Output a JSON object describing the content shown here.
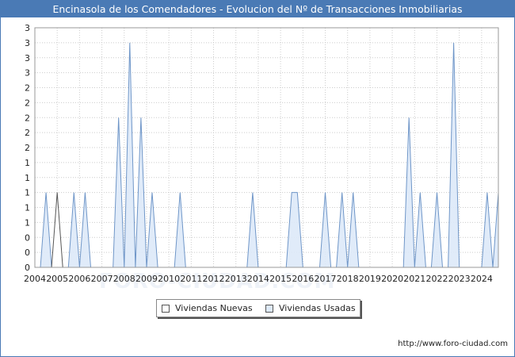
{
  "chart_data": {
    "type": "area",
    "title": "Encinasola de los Comendadores - Evolucion del Nº de Transacciones Inmobiliarias",
    "x_ticks": [
      "2004",
      "2005",
      "2006",
      "2007",
      "2008",
      "2009",
      "2010",
      "2011",
      "2012",
      "2013",
      "2014",
      "2015",
      "2016",
      "2017",
      "2018",
      "2019",
      "2020",
      "2021",
      "2022",
      "2023",
      "2024"
    ],
    "y_ticks": [
      "0",
      "0",
      "0",
      "1",
      "1",
      "1",
      "1",
      "1",
      "2",
      "2",
      "2",
      "2",
      "2",
      "3",
      "3",
      "3",
      "3"
    ],
    "ylim": [
      0,
      3.2
    ],
    "xlim": [
      2004,
      2024.75
    ],
    "grid": true,
    "legend_position": "bottom",
    "series": [
      {
        "name": "Viviendas Nuevas",
        "fill": "#ffffff",
        "stroke": "#555555",
        "points": [
          [
            2004.75,
            0
          ],
          [
            2005.0,
            1
          ],
          [
            2005.25,
            0
          ]
        ]
      },
      {
        "name": "Viviendas Usadas",
        "fill": "#dde9f8",
        "stroke": "#6f96c8",
        "points": [
          [
            2004.25,
            0
          ],
          [
            2004.5,
            1
          ],
          [
            2004.75,
            0
          ],
          [
            2005.5,
            0
          ],
          [
            2005.75,
            1
          ],
          [
            2006.0,
            0
          ],
          [
            2006.25,
            1
          ],
          [
            2006.5,
            0
          ],
          [
            2007.5,
            0
          ],
          [
            2007.75,
            2
          ],
          [
            2008.0,
            0
          ],
          [
            2008.25,
            3
          ],
          [
            2008.5,
            0
          ],
          [
            2008.75,
            2
          ],
          [
            2009.0,
            0
          ],
          [
            2009.25,
            1
          ],
          [
            2009.5,
            0
          ],
          [
            2010.25,
            0
          ],
          [
            2010.5,
            1
          ],
          [
            2010.75,
            0
          ],
          [
            2013.5,
            0
          ],
          [
            2013.75,
            1
          ],
          [
            2014.0,
            0
          ],
          [
            2015.25,
            0
          ],
          [
            2015.5,
            1
          ],
          [
            2015.75,
            1
          ],
          [
            2016.0,
            0
          ],
          [
            2016.75,
            0
          ],
          [
            2017.0,
            1
          ],
          [
            2017.25,
            0
          ],
          [
            2017.5,
            0
          ],
          [
            2017.75,
            1
          ],
          [
            2018.0,
            0
          ],
          [
            2018.25,
            1
          ],
          [
            2018.5,
            0
          ],
          [
            2020.5,
            0
          ],
          [
            2020.75,
            2
          ],
          [
            2021.0,
            0
          ],
          [
            2021.25,
            1
          ],
          [
            2021.5,
            0
          ],
          [
            2021.75,
            0
          ],
          [
            2022.0,
            1
          ],
          [
            2022.25,
            0
          ],
          [
            2022.5,
            0
          ],
          [
            2022.75,
            3
          ],
          [
            2023.0,
            0
          ],
          [
            2024.0,
            0
          ],
          [
            2024.25,
            1
          ],
          [
            2024.5,
            0
          ],
          [
            2024.75,
            1
          ]
        ]
      }
    ]
  },
  "legend": {
    "items": [
      {
        "label": "Viviendas Nuevas"
      },
      {
        "label": "Viviendas Usadas"
      }
    ]
  },
  "footer": {
    "url": "http://www.foro-ciudad.com"
  },
  "watermark": {
    "text": "FORO-CIUDAD.COM"
  }
}
